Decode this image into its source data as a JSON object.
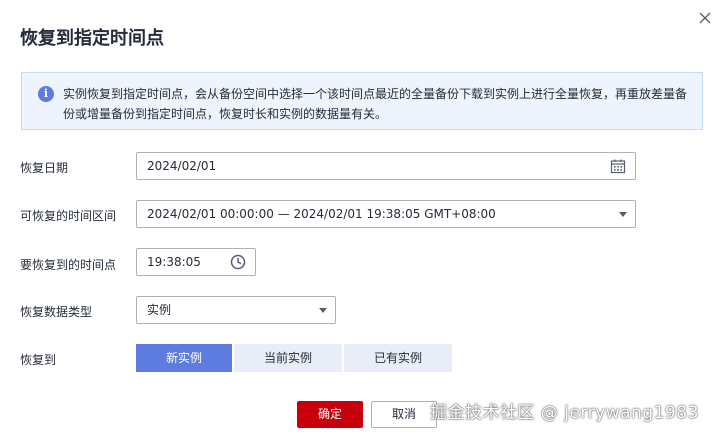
{
  "dialog": {
    "title": "恢复到指定时间点",
    "info_text": "实例恢复到指定时间点，会从备份空间中选择一个该时间点最近的全量备份下载到实例上进行全量恢复，再重放差量备份或增量备份到指定时间点，恢复时长和实例的数据量有关。"
  },
  "form": {
    "restore_date_label": "恢复日期",
    "restore_date_value": "2024/02/01",
    "range_label": "可恢复的时间区间",
    "range_value": "2024/02/01 00:00:00 — 2024/02/01 19:38:05 GMT+08:00",
    "time_label": "要恢复到的时间点",
    "time_value": "19:38:05",
    "data_type_label": "恢复数据类型",
    "data_type_value": "实例",
    "restore_to_label": "恢复到",
    "restore_to_options": [
      "新实例",
      "当前实例",
      "已有实例"
    ]
  },
  "footer": {
    "ok_label": "确定",
    "cancel_label": "取消"
  },
  "watermark": "掘金技术社区 @ jerrywang1983",
  "colors": {
    "primary": "#5e7ce0",
    "danger": "#c7000b",
    "info_bg": "#eef4fd"
  }
}
